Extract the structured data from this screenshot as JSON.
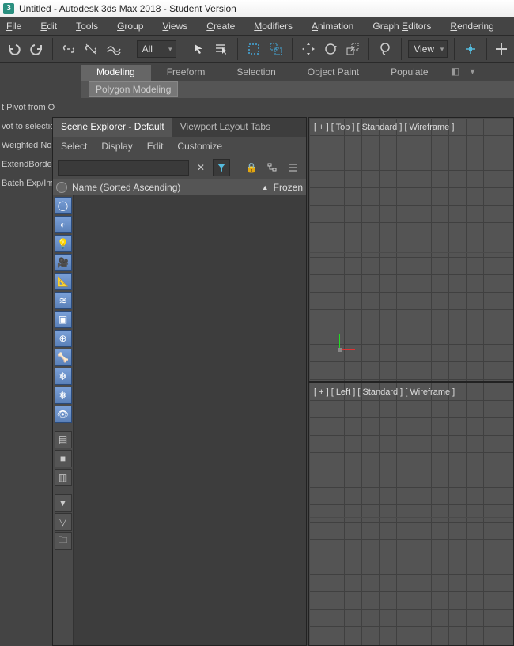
{
  "title": "Untitled - Autodesk 3ds Max 2018 - Student Version",
  "menu": [
    "File",
    "Edit",
    "Tools",
    "Group",
    "Views",
    "Create",
    "Modifiers",
    "Animation",
    "Graph Editors",
    "Rendering"
  ],
  "filter_combo": "All",
  "view_combo": "View",
  "ribbon_tabs": [
    "Modeling",
    "Freeform",
    "Selection",
    "Object Paint",
    "Populate"
  ],
  "ribbon_sub": "Polygon Modeling",
  "left_labels": [
    "t Pivot from O",
    "vot to selectio",
    "Weighted Norm",
    "ExtendBorders",
    "Batch Exp/Imp"
  ],
  "explorer": {
    "tabs": [
      "Scene Explorer - Default",
      "Viewport Layout Tabs"
    ],
    "menu": [
      "Select",
      "Display",
      "Edit",
      "Customize"
    ],
    "col1": "Name (Sorted Ascending)",
    "sort_indicator": "▲",
    "col2": "Frozen"
  },
  "viewport": {
    "top": "[ + ] [ Top ] [ Standard ] [ Wireframe ]",
    "left": "[ + ] [ Left ] [ Standard ] [ Wireframe ]"
  }
}
